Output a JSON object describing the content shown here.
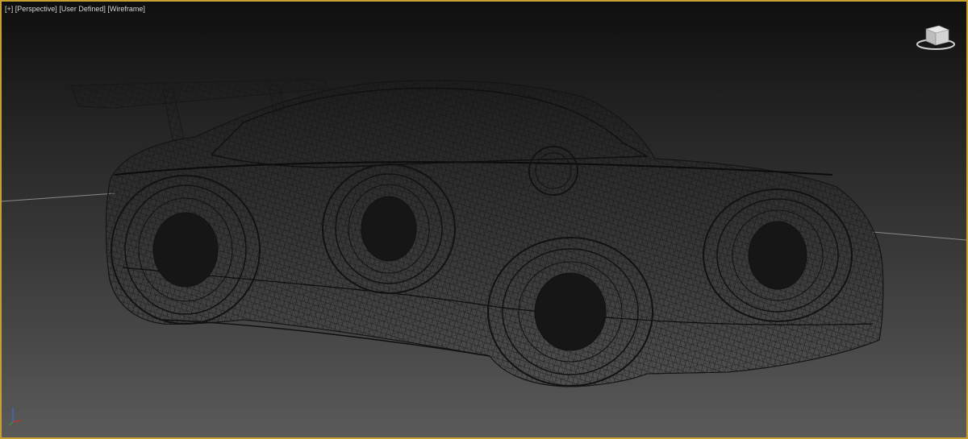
{
  "viewport": {
    "menu_plus": "[+]",
    "view_type": "[Perspective]",
    "shading_user": "[User Defined]",
    "shading_mode": "[Wireframe]"
  },
  "colors": {
    "active_border": "#c8a032",
    "wire": "#141414",
    "grid_line": "#8a8a8a",
    "axis_x": "#c0392b",
    "axis_y": "#2e9a3a",
    "axis_z": "#3b6cd8"
  },
  "icons": {
    "viewcube": "viewcube-icon",
    "axis": "axis-tripod-icon"
  }
}
